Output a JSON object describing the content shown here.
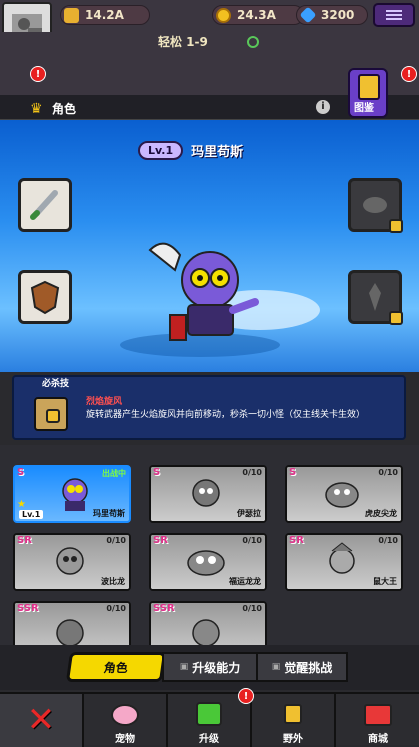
{
  "topbar": {
    "stamina": "14.2A",
    "gold": "24.3A",
    "gems": "3200"
  },
  "stage": {
    "label": "轻松 1-9"
  },
  "header": {
    "title": "角色",
    "codex_label": "图鉴"
  },
  "hero": {
    "level": "Lv.1",
    "name": "玛里苟斯"
  },
  "skill": {
    "section_label": "必杀技",
    "name": "烈焰旋风",
    "desc": "旋转武器产生火焰旋风并向前移动，秒杀一切小怪（仅主线关卡生效）"
  },
  "cards": [
    {
      "rarity": "S",
      "count": "",
      "name": "玛里苟斯",
      "level": "Lv.1",
      "status": "出战中",
      "active": true
    },
    {
      "rarity": "S",
      "count": "0/10",
      "name": "伊瑟拉"
    },
    {
      "rarity": "S",
      "count": "0/10",
      "name": "虎皮尖龙"
    },
    {
      "rarity": "SR",
      "count": "0/10",
      "name": "波比龙"
    },
    {
      "rarity": "SR",
      "count": "0/10",
      "name": "福运龙龙"
    },
    {
      "rarity": "SR",
      "count": "0/10",
      "name": "鼠大王"
    },
    {
      "rarity": "SSR",
      "count": "0/10",
      "name": ""
    },
    {
      "rarity": "SSR",
      "count": "0/10",
      "name": ""
    }
  ],
  "tabs": {
    "role": "角色",
    "upgrade": "升级能力",
    "awaken": "觉醒挑战"
  },
  "nav": {
    "pet": "宠物",
    "upgrade": "升级",
    "wild": "野外",
    "shop": "商城",
    "upgrade_badge": "!"
  },
  "colors": {
    "active_tab": "#f5d800",
    "card_active": "#1a8cff",
    "rarity": "#e0308a"
  }
}
